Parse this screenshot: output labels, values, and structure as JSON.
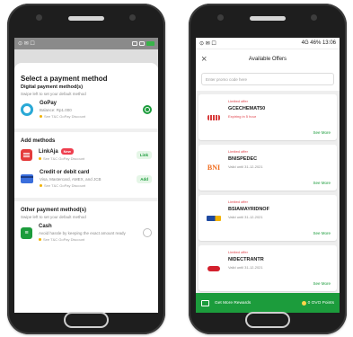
{
  "payment_screen": {
    "status_bar": {
      "left": "⊙ ✉ ☐"
    },
    "title": "Select a payment method",
    "subtitle": "Digital payment method(s)",
    "subtitle_hint": "Swipe left to set your default method",
    "gopay": {
      "name": "GoPay",
      "detail": "Balance: Rp1.000",
      "note": "See T&C GoPay Discount"
    },
    "add_methods_heading": "Add methods",
    "linkaja": {
      "name": "LinkAja",
      "badge": "New",
      "note": "See T&C GoPay Discount",
      "action": "Link"
    },
    "card": {
      "name": "Credit or debit card",
      "detail": "Visa, Mastercard, AMEX, and JCB",
      "note": "See T&C GoPay Discount",
      "action": "Add"
    },
    "other_heading": "Other payment method(s)",
    "other_hint": "Swipe left to set your default method",
    "cash": {
      "name": "Cash",
      "detail": "Avoid hassle by keeping the exact amount ready",
      "note": "See T&C GoPay Discount"
    }
  },
  "offers_screen": {
    "status_bar": {
      "left": "⊙ ✉ ☐",
      "right": "4G 46% 13:06"
    },
    "title": "Available Offers",
    "promo_placeholder": "Enter promo code here",
    "offers": [
      {
        "tag": "Limited offer",
        "code": "GCECHEMAT50",
        "meta": "Expiring in 5 hour",
        "action": "See More",
        "logo": "cc"
      },
      {
        "tag": "Limited offer",
        "code": "BNISPEDEC",
        "meta": "Valid until 31-12-2021",
        "action": "See More",
        "logo": "BNI"
      },
      {
        "tag": "Limited offer",
        "code": "BSIAMAYRIDNOF",
        "meta": "Valid until 31-12-2021",
        "action": "See More",
        "logo": "mandiri"
      },
      {
        "tag": "Limited offer",
        "code": "NIDECTRANTR",
        "meta": "Valid until 31-12-2021",
        "action": "See More",
        "logo": "cimb"
      }
    ],
    "footer": {
      "label": "Get More Rewards",
      "points": "0 OVO Points"
    }
  },
  "colors": {
    "accent_green": "#1c9c3c",
    "alert_red": "#e0424a",
    "gopay_blue": "#2aa9d6"
  },
  "icons": [
    "gopay-icon",
    "linkaja-icon",
    "card-icon",
    "cash-icon",
    "close-icon",
    "coin-icon"
  ]
}
